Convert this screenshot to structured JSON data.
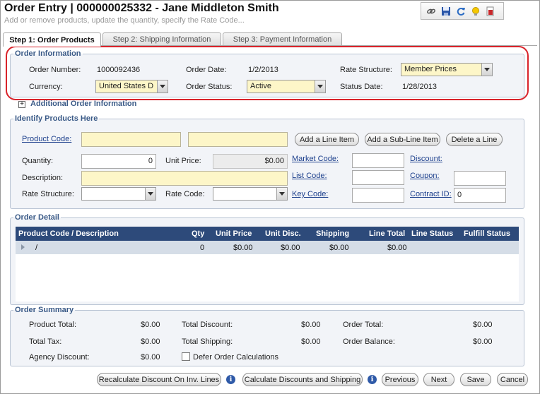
{
  "header": {
    "title": "Order Entry | 000000025332 - Jane Middleton Smith",
    "subtitle": "Add or remove products, update the quantity, specify the Rate Code..."
  },
  "toolbar": {
    "icons": [
      "link-icon",
      "save-icon",
      "refresh-icon",
      "lightbulb-icon",
      "report-icon"
    ]
  },
  "tabs": [
    {
      "label": "Step 1: Order Products",
      "active": true
    },
    {
      "label": "Step 2: Shipping Information",
      "active": false
    },
    {
      "label": "Step 3: Payment Information",
      "active": false
    }
  ],
  "order_info": {
    "legend": "Order Information",
    "order_number_label": "Order Number:",
    "order_number": "1000092436",
    "order_date_label": "Order Date:",
    "order_date": "1/2/2013",
    "rate_structure_label": "Rate Structure:",
    "rate_structure": "Member Prices",
    "currency_label": "Currency:",
    "currency": "United States D",
    "order_status_label": "Order Status:",
    "order_status": "Active",
    "status_date_label": "Status Date:",
    "status_date": "1/28/2013"
  },
  "additional": {
    "label": "Additional Order Information",
    "toggle": "+"
  },
  "identify": {
    "legend": "Identify Products Here",
    "product_code_link": "Product Code:",
    "add_line_item": "Add a Line Item",
    "add_sub_line_item": "Add a Sub-Line Item",
    "delete_line": "Delete a Line",
    "quantity_label": "Quantity:",
    "quantity": "0",
    "unit_price_label": "Unit Price:",
    "unit_price": "$0.00",
    "market_code_link": "Market Code:",
    "discount_link": "Discount:",
    "description_label": "Description:",
    "list_code_link": "List Code:",
    "coupon_link": "Coupon:",
    "rate_structure_label": "Rate Structure:",
    "rate_code_label": "Rate Code:",
    "key_code_link": "Key Code:",
    "contract_id_link": "Contract ID:",
    "contract_id": "0"
  },
  "order_detail": {
    "legend": "Order Detail",
    "columns": [
      "Product Code / Description",
      "Qty",
      "Unit Price",
      "Unit Disc.",
      "Shipping",
      "Line Total",
      "Line Status",
      "Fulfill Status"
    ],
    "rows": [
      {
        "product": "/",
        "qty": "0",
        "unit_price": "$0.00",
        "unit_disc": "$0.00",
        "shipping": "$0.00",
        "line_total": "$0.00",
        "line_status": "",
        "fulfill_status": ""
      }
    ]
  },
  "summary": {
    "legend": "Order Summary",
    "product_total_label": "Product Total:",
    "product_total": "$0.00",
    "total_discount_label": "Total Discount:",
    "total_discount": "$0.00",
    "order_total_label": "Order Total:",
    "order_total": "$0.00",
    "total_tax_label": "Total Tax:",
    "total_tax": "$0.00",
    "total_shipping_label": "Total Shipping:",
    "total_shipping": "$0.00",
    "order_balance_label": "Order Balance:",
    "order_balance": "$0.00",
    "agency_discount_label": "Agency Discount:",
    "agency_discount": "$0.00",
    "defer_label": "Defer Order Calculations"
  },
  "footer": {
    "recalc_label": "Recalculate Discount On Inv. Lines",
    "calc_label": "Calculate Discounts and Shipping",
    "info_glyph": "i",
    "previous_label": "Previous",
    "next_label": "Next",
    "save_label": "Save",
    "cancel_label": "Cancel"
  },
  "colors": {
    "highlight": "#d9232a",
    "header_blue": "#2d4a7a",
    "link": "#1c3f8c",
    "required_yellow": "#fdf6c8"
  }
}
